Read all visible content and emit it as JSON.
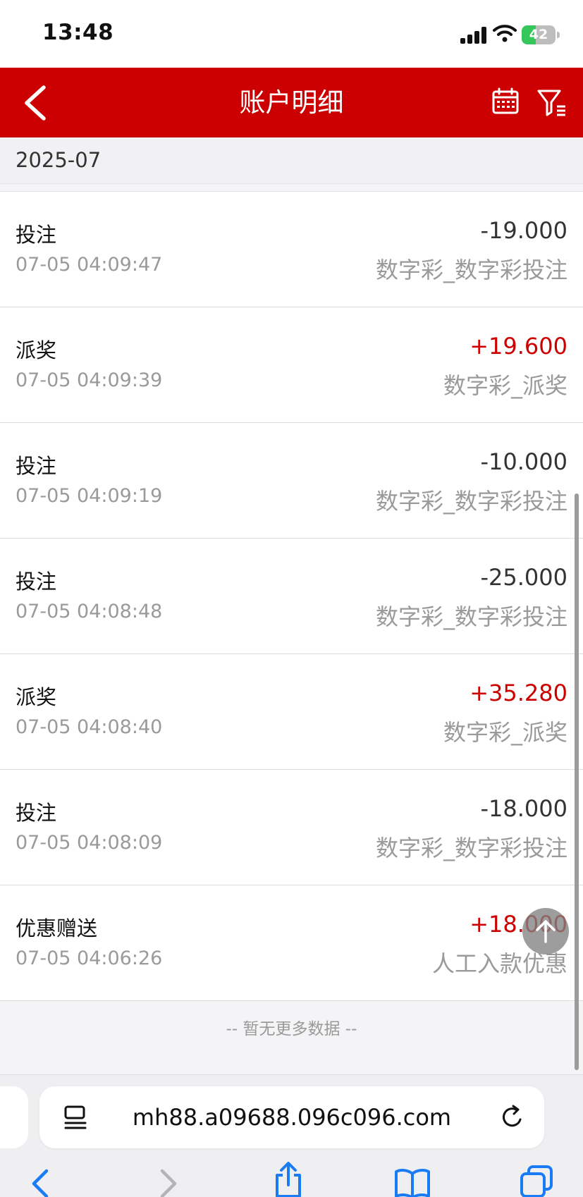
{
  "status_bar": {
    "time": "13:48",
    "battery": "42",
    "battery_level": 0.42,
    "icons": [
      "signal-icon",
      "wifi-icon",
      "battery-icon"
    ]
  },
  "header": {
    "title": "账户明细",
    "background": "#cc0000",
    "icons": [
      "back-chevron-icon",
      "calendar-icon",
      "filter-icon"
    ]
  },
  "month": "2025-07",
  "transactions": [
    {
      "type": "投注",
      "time": "07-05 04:09:47",
      "amount": "-19.000",
      "category": "数字彩_数字彩投注",
      "sign": "neg"
    },
    {
      "type": "派奖",
      "time": "07-05 04:09:39",
      "amount": "+19.600",
      "category": "数字彩_派奖",
      "sign": "pos"
    },
    {
      "type": "投注",
      "time": "07-05 04:09:19",
      "amount": "-10.000",
      "category": "数字彩_数字彩投注",
      "sign": "neg"
    },
    {
      "type": "投注",
      "time": "07-05 04:08:48",
      "amount": "-25.000",
      "category": "数字彩_数字彩投注",
      "sign": "neg"
    },
    {
      "type": "派奖",
      "time": "07-05 04:08:40",
      "amount": "+35.280",
      "category": "数字彩_派奖",
      "sign": "pos"
    },
    {
      "type": "投注",
      "time": "07-05 04:08:09",
      "amount": "-18.000",
      "category": "数字彩_数字彩投注",
      "sign": "neg"
    },
    {
      "type": "优惠赠送",
      "time": "07-05 04:06:26",
      "amount": "+18.000",
      "category": "人工入款优惠",
      "sign": "pos"
    }
  ],
  "colors": {
    "positive": "#cc0000",
    "negative": "#333333",
    "muted": "#9a9a9a"
  },
  "footer_text": "-- 暂无更多数据 --",
  "browser": {
    "url": "mh88.a09688.096c096.com",
    "icons": [
      "page-menu-icon",
      "reload-icon",
      "back-icon",
      "forward-icon",
      "share-icon",
      "bookmarks-icon",
      "tabs-icon",
      "arrow-up-icon"
    ]
  }
}
